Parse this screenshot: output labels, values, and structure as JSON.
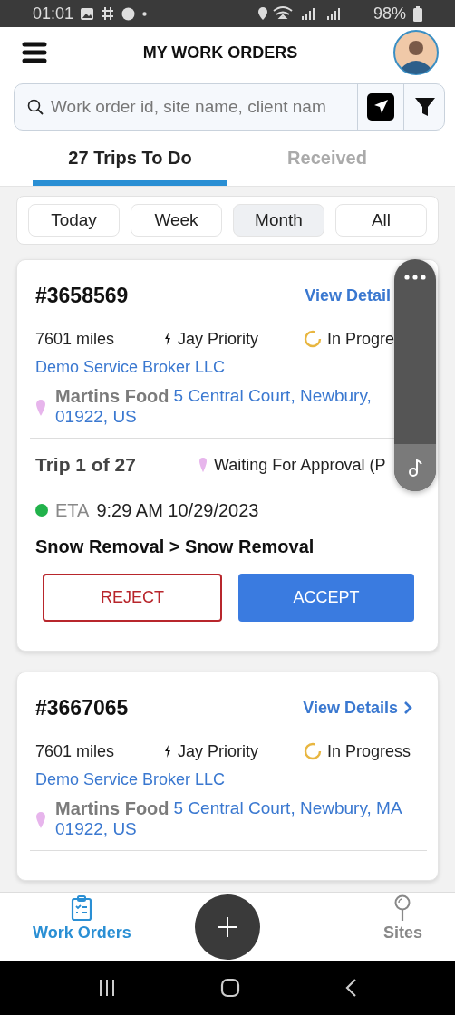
{
  "status_bar": {
    "time": "01:01",
    "battery": "98%"
  },
  "header": {
    "title": "MY WORK ORDERS"
  },
  "search": {
    "placeholder": "Work order id, site name, client nam"
  },
  "tabs": [
    {
      "label": "27 Trips To Do",
      "selected": true
    },
    {
      "label": "Received",
      "selected": false
    }
  ],
  "periods": [
    {
      "label": "Today",
      "selected": false
    },
    {
      "label": "Week",
      "selected": false
    },
    {
      "label": "Month",
      "selected": true
    },
    {
      "label": "All",
      "selected": false
    }
  ],
  "orders": [
    {
      "id": "#3658569",
      "view_details": "View Detail",
      "distance": "7601 miles",
      "priority": "Jay Priority",
      "status": "In Progre",
      "broker": "Demo Service Broker LLC",
      "site": "Martins Food",
      "address": [
        "5 Central Court, Newbury,",
        "01922, US"
      ],
      "trip": "Trip 1 of 27",
      "trip_status": "Waiting For Approval (P",
      "eta_label": "ETA",
      "eta": "9:29 AM 10/29/2023",
      "service": "Snow Removal > Snow Removal",
      "reject": "REJECT",
      "accept": "ACCEPT"
    },
    {
      "id": "#3667065",
      "view_details": "View Details",
      "distance": "7601 miles",
      "priority": "Jay Priority",
      "status": "In Progress",
      "broker": "Demo Service Broker LLC",
      "site": "Martins Food",
      "address": [
        "5 Central Court, Newbury, MA",
        "01922, US"
      ]
    }
  ],
  "bottom_nav": [
    {
      "label": "Work Orders",
      "selected": true,
      "kind": "orders"
    },
    {
      "label": "Sites",
      "selected": false,
      "kind": "sites"
    }
  ]
}
